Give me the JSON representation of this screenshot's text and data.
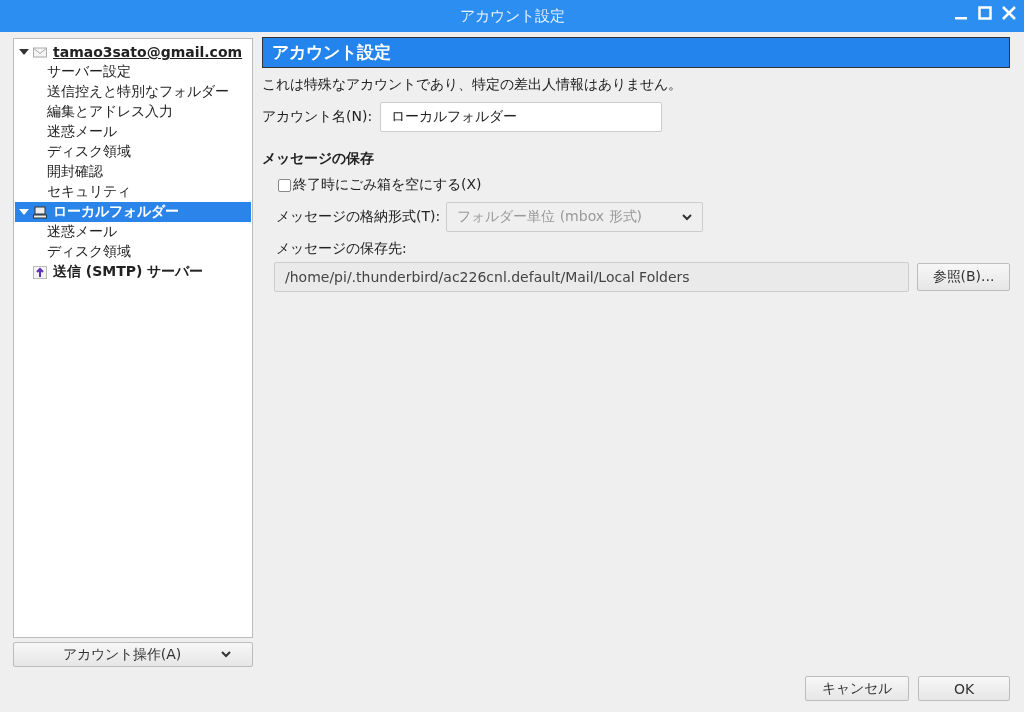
{
  "window": {
    "title": "アカウント設定"
  },
  "tree": [
    {
      "label": "tamao3sato@gmail.com",
      "kind": "mail",
      "expanded": true,
      "selected": false,
      "children": [
        {
          "label": "サーバー設定",
          "selected": false
        },
        {
          "label": "送信控えと特別なフォルダー",
          "selected": false
        },
        {
          "label": "編集とアドレス入力",
          "selected": false
        },
        {
          "label": "迷惑メール",
          "selected": false
        },
        {
          "label": "ディスク領域",
          "selected": false
        },
        {
          "label": "開封確認",
          "selected": false
        },
        {
          "label": "セキュリティ",
          "selected": false
        }
      ]
    },
    {
      "label": "ローカルフォルダー",
      "kind": "local",
      "expanded": true,
      "selected": true,
      "children": [
        {
          "label": "迷惑メール",
          "selected": false
        },
        {
          "label": "ディスク領域",
          "selected": false
        }
      ]
    },
    {
      "label": "送信 (SMTP) サーバー",
      "kind": "smtp",
      "selected": false
    }
  ],
  "account_actions": {
    "label": "アカウント操作(A)"
  },
  "panel": {
    "heading": "アカウント設定",
    "note": "これは特殊なアカウントであり、特定の差出人情報はありません。",
    "account_name": {
      "label": "アカウント名(N):",
      "value": "ローカルフォルダー"
    },
    "section": "メッセージの保存",
    "empty_trash": {
      "label": "終了時にごみ箱を空にする(X)",
      "checked": false
    },
    "store_type": {
      "label": "メッセージの格納形式(T):",
      "value": "フォルダー単位 (mbox 形式)",
      "disabled": true
    },
    "store_path": {
      "label": "メッセージの保存先:",
      "value": "/home/pi/.thunderbird/ac226cnl.default/Mail/Local Folders"
    },
    "browse": "参照(B)..."
  },
  "buttons": [
    "キャンセル",
    "OK"
  ]
}
